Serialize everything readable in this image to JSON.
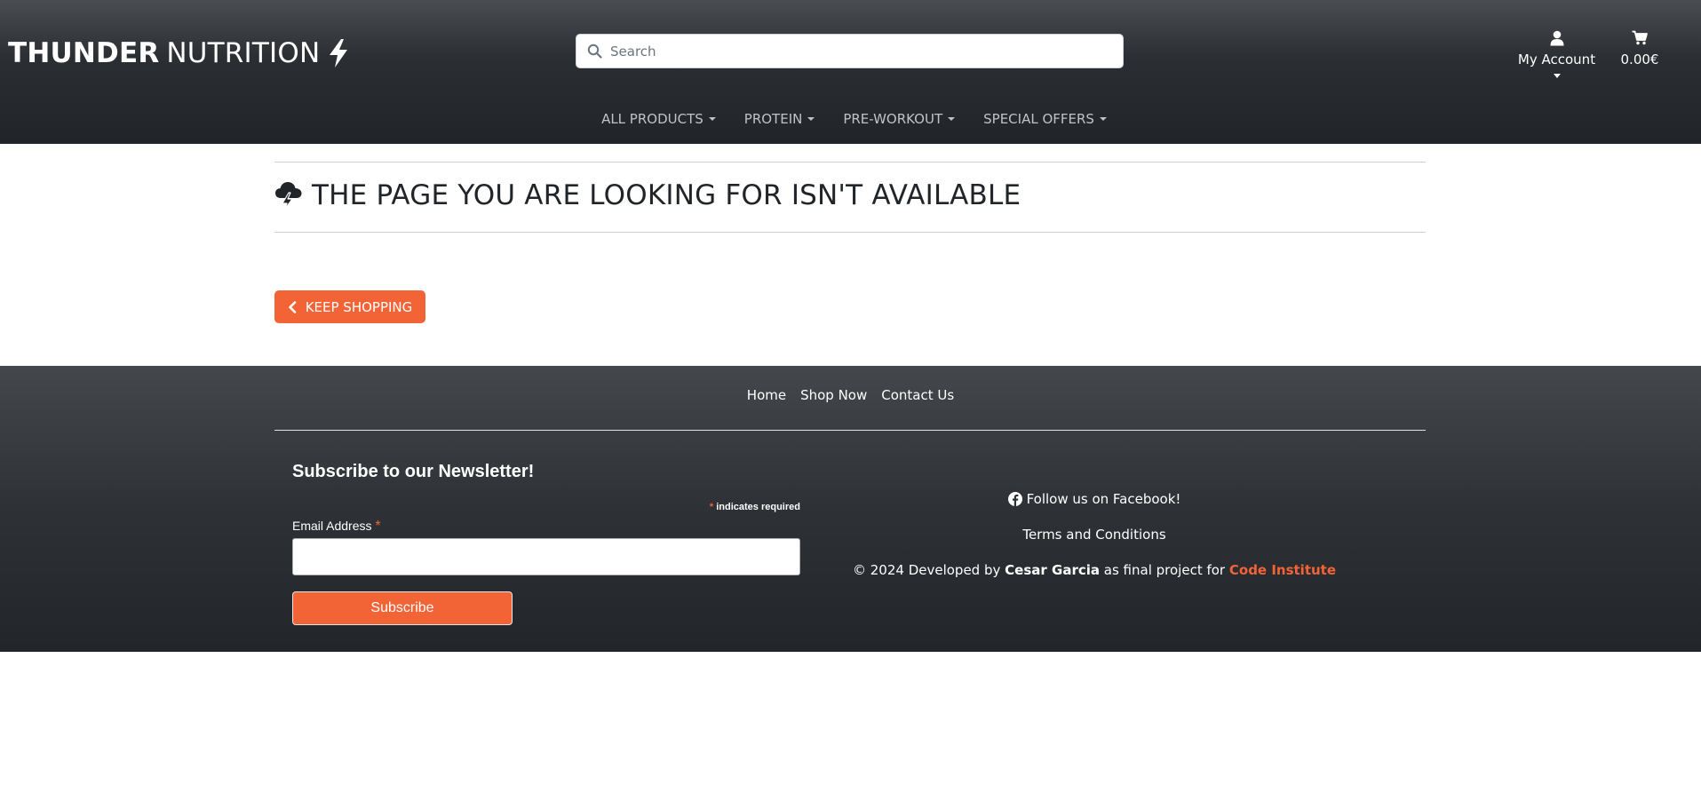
{
  "header": {
    "brand_bold": "THUNDER",
    "brand_light": "NUTRITION",
    "brand_icon": "bolt-icon",
    "search": {
      "placeholder": "Search",
      "value": "",
      "icon": "search-icon"
    },
    "account": {
      "label": "My Account",
      "icon": "user-icon"
    },
    "cart": {
      "total": "0.00€",
      "icon": "shopping-cart-icon"
    },
    "nav": [
      {
        "label": "ALL PRODUCTS"
      },
      {
        "label": "PROTEIN"
      },
      {
        "label": "PRE-WORKOUT"
      },
      {
        "label": "SPECIAL OFFERS"
      }
    ]
  },
  "main": {
    "title": "THE PAGE YOU ARE LOOKING FOR ISN'T AVAILABLE",
    "title_icon": "cloud-bolt-icon",
    "button_label": "KEEP SHOPPING",
    "button_icon": "chevron-left-icon"
  },
  "footer": {
    "links": [
      "Home",
      "Shop Now",
      "Contact Us"
    ],
    "newsletter": {
      "heading": "Subscribe to our Newsletter!",
      "required_star": "*",
      "required_note": "indicates required",
      "email_label": "Email Address",
      "email_value": "",
      "subscribe_label": "Subscribe"
    },
    "facebook": {
      "text": "Follow us on Facebook!",
      "icon": "facebook-icon"
    },
    "terms": "Terms and Conditions",
    "copyright": {
      "prefix": "© 2024 Developed by",
      "author": "Cesar Garcia",
      "middle": "as final project for",
      "school": "Code Institute"
    }
  },
  "colors": {
    "accent": "#f26336",
    "header_dark": "#212428",
    "footer_dark": "#2e3135",
    "nav_text": "#bfc3c7"
  }
}
